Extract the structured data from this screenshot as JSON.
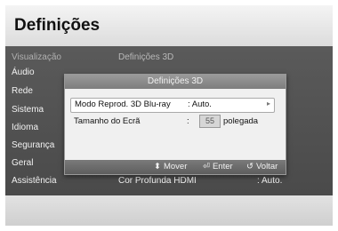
{
  "title": "Definições",
  "menu": {
    "items": [
      {
        "label": "Visualização",
        "dim": true
      },
      {
        "label": "Áudio"
      },
      {
        "label": "Rede"
      },
      {
        "label": "Sistema"
      },
      {
        "label": "Idioma"
      },
      {
        "label": "Segurança"
      },
      {
        "label": "Geral"
      },
      {
        "label": "Assistência"
      }
    ],
    "submenu_title": "Definições 3D",
    "bottom_row": {
      "label": "Cor Profunda HDMI",
      "value": ": Auto."
    }
  },
  "dialog": {
    "title": "Definições 3D",
    "rows": [
      {
        "label": "Modo Reprod. 3D Blu-ray",
        "value": ": Auto.",
        "selected": true,
        "arrow": "▸"
      },
      {
        "label": "Tamanho do Ecrã",
        "value": ":",
        "number": "55",
        "unit": "polegada"
      }
    ],
    "footer": {
      "move": {
        "icon": "⬍",
        "label": "Mover"
      },
      "enter": {
        "icon": "⏎",
        "label": "Enter"
      },
      "back": {
        "icon": "↺",
        "label": "Voltar"
      }
    }
  }
}
